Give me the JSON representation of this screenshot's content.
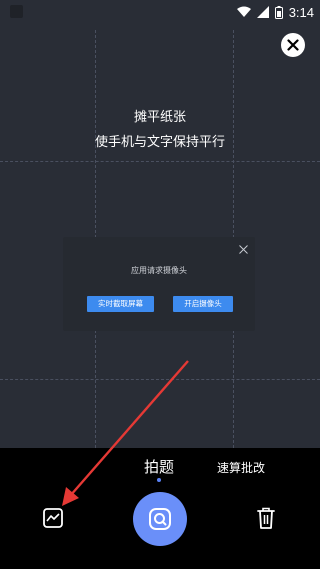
{
  "status_bar": {
    "time": "3:14",
    "icons": [
      "app-icon",
      "wifi-icon",
      "signal-icon",
      "battery-icon"
    ]
  },
  "overlay": {
    "hint_line1": "摊平纸张",
    "hint_line2": "使手机与文字保持平行"
  },
  "dialog": {
    "title": "应用请求摄像头",
    "button_left": "实时截取屏幕",
    "button_right": "开启摄像头"
  },
  "bottom": {
    "mode_tabs": [
      "拍题",
      "速算批改"
    ],
    "active_tab": "拍题",
    "accent_color": "#6a8ff9"
  },
  "annotation": {
    "arrow_color": "#e53935"
  }
}
